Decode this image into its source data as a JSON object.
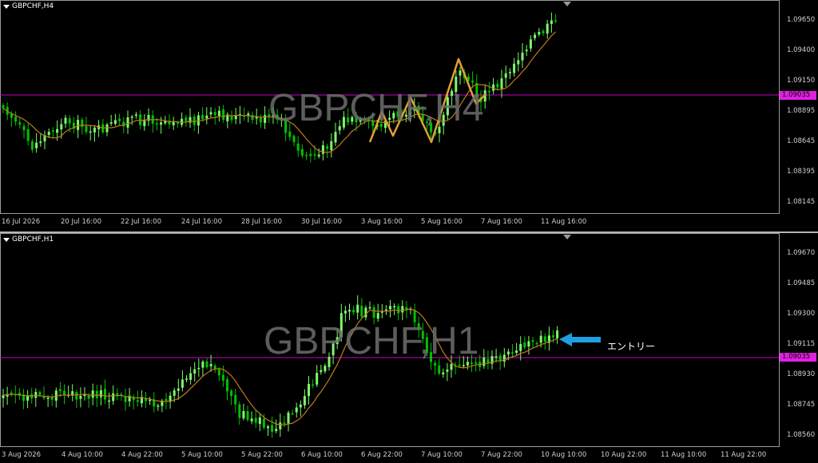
{
  "top": {
    "title": "GBPCHF,H4",
    "watermark": "GBPCHF,H4",
    "price_axis": [
      "1.09650",
      "1.09400",
      "1.09150",
      "1.08895",
      "1.08645",
      "1.08395",
      "1.08145"
    ],
    "level_tag": "1.09035",
    "time_axis": [
      "16 Jul 2026",
      "20 Jul 16:00",
      "22 Jul 16:00",
      "24 Jul 16:00",
      "28 Jul 16:00",
      "30 Jul 16:00",
      "3 Aug 16:00",
      "5 Aug 16:00",
      "7 Aug 16:00",
      "11 Aug 16:00"
    ]
  },
  "bottom": {
    "title": "GBPCHF,H1",
    "watermark": "GBPCHF,H1",
    "price_axis": [
      "1.09670",
      "1.09485",
      "1.09300",
      "1.09115",
      "1.08930",
      "1.08745",
      "1.08560"
    ],
    "level_tag": "1.09035",
    "time_axis": [
      "3 Aug 2026",
      "4 Aug 10:00",
      "4 Aug 22:00",
      "5 Aug 10:00",
      "5 Aug 22:00",
      "6 Aug 10:00",
      "6 Aug 22:00",
      "7 Aug 10:00",
      "7 Aug 22:00",
      "10 Aug 10:00",
      "10 Aug 22:00",
      "11 Aug 10:00",
      "11 Aug 22:00"
    ],
    "annotation": "エントリー"
  },
  "colors": {
    "bull": "#7cfc6a",
    "bear": "#00c000",
    "ma": "#c07a1a",
    "level": "#c800c8",
    "zigzag": "#e0a030",
    "arrow": "#1ea0e0"
  },
  "level_price": 1.09035
}
